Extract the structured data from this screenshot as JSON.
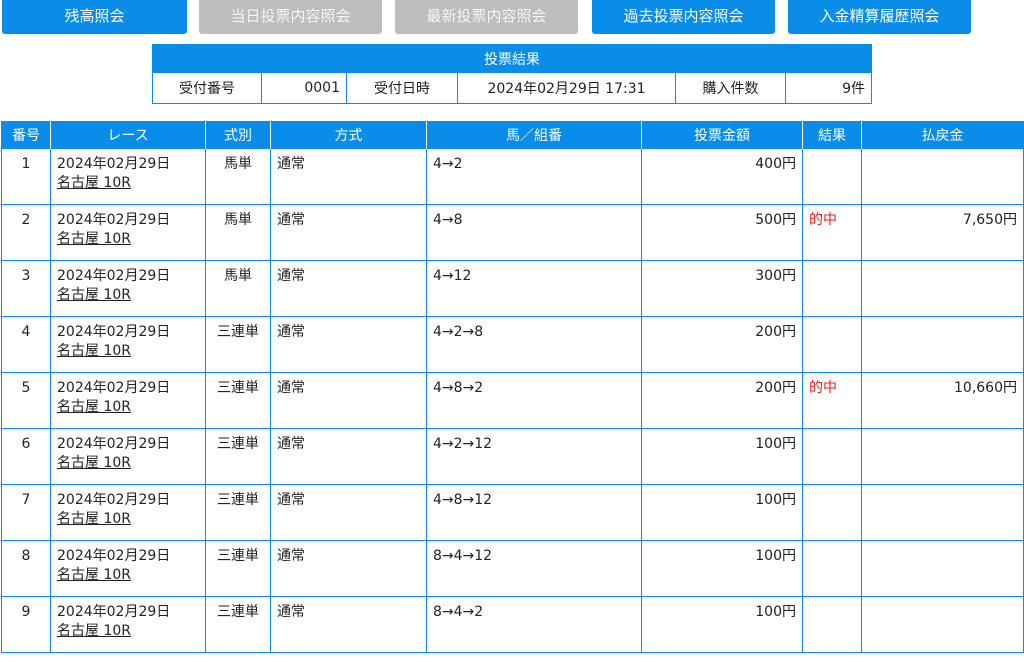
{
  "nav": {
    "buttons": [
      {
        "label": "残高照会",
        "enabled": true
      },
      {
        "label": "当日投票内容照会",
        "enabled": false
      },
      {
        "label": "最新投票内容照会",
        "enabled": false
      },
      {
        "label": "過去投票内容照会",
        "enabled": true
      },
      {
        "label": "入金精算履歴照会",
        "enabled": true
      }
    ]
  },
  "summary": {
    "title": "投票結果",
    "receipt_no_label": "受付番号",
    "receipt_no": "0001",
    "receipt_time_label": "受付日時",
    "receipt_time": "2024年02月29日 17:31",
    "count_label": "購入件数",
    "count": "9件"
  },
  "table": {
    "headers": {
      "no": "番号",
      "race": "レース",
      "type": "式別",
      "method": "方式",
      "combination": "馬／組番",
      "amount": "投票金額",
      "result": "結果",
      "payout": "払戻金"
    },
    "rows": [
      {
        "no": "1",
        "date": "2024年02月29日",
        "race": "名古屋 10R",
        "type": "馬単",
        "method": "通常",
        "combination": "4→2",
        "amount": "400円",
        "result": "",
        "payout": ""
      },
      {
        "no": "2",
        "date": "2024年02月29日",
        "race": "名古屋 10R",
        "type": "馬単",
        "method": "通常",
        "combination": "4→8",
        "amount": "500円",
        "result": "的中",
        "payout": "7,650円"
      },
      {
        "no": "3",
        "date": "2024年02月29日",
        "race": "名古屋 10R",
        "type": "馬単",
        "method": "通常",
        "combination": "4→12",
        "amount": "300円",
        "result": "",
        "payout": ""
      },
      {
        "no": "4",
        "date": "2024年02月29日",
        "race": "名古屋 10R",
        "type": "三連単",
        "method": "通常",
        "combination": "4→2→8",
        "amount": "200円",
        "result": "",
        "payout": ""
      },
      {
        "no": "5",
        "date": "2024年02月29日",
        "race": "名古屋 10R",
        "type": "三連単",
        "method": "通常",
        "combination": "4→8→2",
        "amount": "200円",
        "result": "的中",
        "payout": "10,660円"
      },
      {
        "no": "6",
        "date": "2024年02月29日",
        "race": "名古屋 10R",
        "type": "三連単",
        "method": "通常",
        "combination": "4→2→12",
        "amount": "100円",
        "result": "",
        "payout": ""
      },
      {
        "no": "7",
        "date": "2024年02月29日",
        "race": "名古屋 10R",
        "type": "三連単",
        "method": "通常",
        "combination": "4→8→12",
        "amount": "100円",
        "result": "",
        "payout": ""
      },
      {
        "no": "8",
        "date": "2024年02月29日",
        "race": "名古屋 10R",
        "type": "三連単",
        "method": "通常",
        "combination": "8→4→12",
        "amount": "100円",
        "result": "",
        "payout": ""
      },
      {
        "no": "9",
        "date": "2024年02月29日",
        "race": "名古屋 10R",
        "type": "三連単",
        "method": "通常",
        "combination": "8→4→2",
        "amount": "100円",
        "result": "",
        "payout": ""
      }
    ]
  },
  "colors": {
    "accent": "#0a8de8",
    "disabled": "#bdbdbd",
    "hit": "#e8221b"
  }
}
